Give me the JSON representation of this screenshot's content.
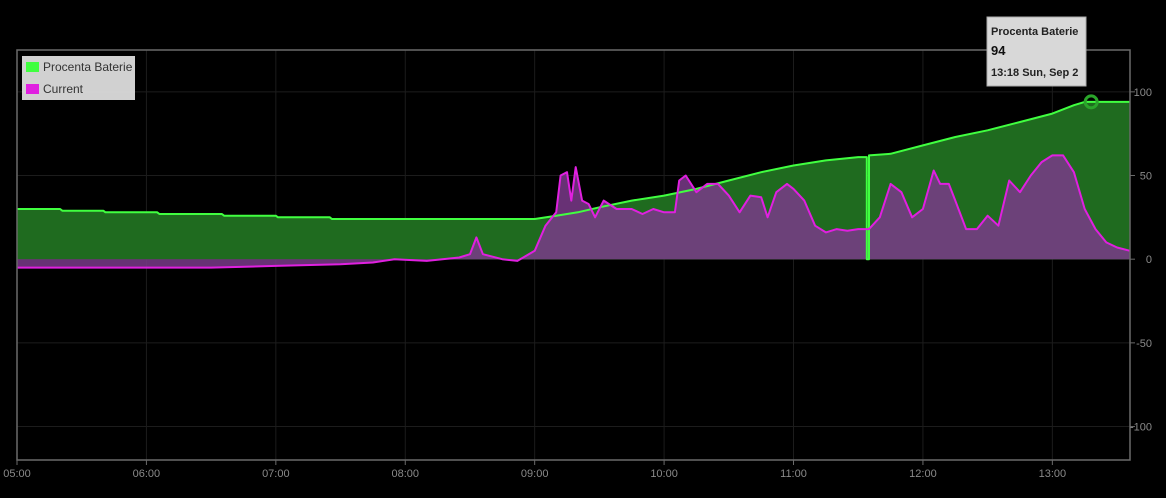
{
  "chart_data": {
    "type": "area",
    "x_range": [
      "05:00",
      "13:36"
    ],
    "x_ticks": [
      "05:00",
      "06:00",
      "07:00",
      "08:00",
      "09:00",
      "10:00",
      "11:00",
      "12:00",
      "13:00"
    ],
    "y_ticks": [
      "100",
      "50",
      "0",
      "-50",
      "-100"
    ],
    "ylim": [
      -120,
      125
    ],
    "y_axis_side": "right",
    "grid": true,
    "legend_placement": "top-left",
    "series": [
      {
        "name": "Procenta Baterie",
        "color": "#40ff40",
        "fill": "#1f6b1f",
        "points": [
          [
            "05:00",
            30
          ],
          [
            "05:20",
            30
          ],
          [
            "05:21",
            29
          ],
          [
            "05:40",
            29
          ],
          [
            "05:41",
            28
          ],
          [
            "06:05",
            28
          ],
          [
            "06:06",
            27
          ],
          [
            "06:35",
            27
          ],
          [
            "06:36",
            26
          ],
          [
            "07:00",
            26
          ],
          [
            "07:01",
            25
          ],
          [
            "07:25",
            25
          ],
          [
            "07:26",
            24
          ],
          [
            "09:00",
            24
          ],
          [
            "09:10",
            26
          ],
          [
            "09:20",
            28
          ],
          [
            "09:30",
            31
          ],
          [
            "09:45",
            35
          ],
          [
            "10:00",
            38
          ],
          [
            "10:15",
            42
          ],
          [
            "10:30",
            47
          ],
          [
            "10:45",
            52
          ],
          [
            "11:00",
            56
          ],
          [
            "11:15",
            59
          ],
          [
            "11:30",
            61
          ],
          [
            "11:34",
            61
          ],
          [
            "11:34",
            0
          ],
          [
            "11:35",
            0
          ],
          [
            "11:35",
            62
          ],
          [
            "11:45",
            63
          ],
          [
            "12:00",
            68
          ],
          [
            "12:15",
            73
          ],
          [
            "12:30",
            77
          ],
          [
            "12:45",
            82
          ],
          [
            "13:00",
            87
          ],
          [
            "13:10",
            92
          ],
          [
            "13:15",
            94
          ],
          [
            "13:36",
            94
          ]
        ]
      },
      {
        "name": "Current",
        "color": "#e020e0",
        "fill": "#7a3a8a",
        "points": [
          [
            "05:00",
            -5
          ],
          [
            "05:30",
            -5
          ],
          [
            "06:00",
            -5
          ],
          [
            "06:30",
            -5
          ],
          [
            "07:00",
            -4
          ],
          [
            "07:30",
            -3
          ],
          [
            "07:45",
            -2
          ],
          [
            "07:55",
            0
          ],
          [
            "08:10",
            -1
          ],
          [
            "08:25",
            1
          ],
          [
            "08:30",
            3
          ],
          [
            "08:33",
            13
          ],
          [
            "08:36",
            3
          ],
          [
            "08:45",
            0
          ],
          [
            "08:52",
            -1
          ],
          [
            "09:00",
            5
          ],
          [
            "09:05",
            20
          ],
          [
            "09:10",
            28
          ],
          [
            "09:12",
            50
          ],
          [
            "09:15",
            52
          ],
          [
            "09:17",
            35
          ],
          [
            "09:19",
            55
          ],
          [
            "09:22",
            35
          ],
          [
            "09:25",
            33
          ],
          [
            "09:28",
            25
          ],
          [
            "09:32",
            35
          ],
          [
            "09:38",
            30
          ],
          [
            "09:45",
            30
          ],
          [
            "09:50",
            27
          ],
          [
            "09:55",
            30
          ],
          [
            "10:00",
            28
          ],
          [
            "10:05",
            28
          ],
          [
            "10:07",
            47
          ],
          [
            "10:10",
            50
          ],
          [
            "10:15",
            40
          ],
          [
            "10:20",
            45
          ],
          [
            "10:25",
            45
          ],
          [
            "10:30",
            38
          ],
          [
            "10:35",
            28
          ],
          [
            "10:40",
            38
          ],
          [
            "10:45",
            37
          ],
          [
            "10:48",
            25
          ],
          [
            "10:52",
            40
          ],
          [
            "10:57",
            45
          ],
          [
            "11:00",
            42
          ],
          [
            "11:05",
            35
          ],
          [
            "11:10",
            20
          ],
          [
            "11:15",
            16
          ],
          [
            "11:20",
            18
          ],
          [
            "11:25",
            17
          ],
          [
            "11:30",
            18
          ],
          [
            "11:35",
            18
          ],
          [
            "11:40",
            25
          ],
          [
            "11:45",
            45
          ],
          [
            "11:50",
            40
          ],
          [
            "11:55",
            25
          ],
          [
            "12:00",
            30
          ],
          [
            "12:05",
            53
          ],
          [
            "12:08",
            45
          ],
          [
            "12:12",
            45
          ],
          [
            "12:15",
            35
          ],
          [
            "12:20",
            18
          ],
          [
            "12:25",
            18
          ],
          [
            "12:30",
            26
          ],
          [
            "12:35",
            20
          ],
          [
            "12:40",
            47
          ],
          [
            "12:45",
            40
          ],
          [
            "12:50",
            50
          ],
          [
            "12:55",
            58
          ],
          [
            "13:00",
            62
          ],
          [
            "13:05",
            62
          ],
          [
            "13:10",
            52
          ],
          [
            "13:15",
            30
          ],
          [
            "13:20",
            18
          ],
          [
            "13:25",
            10
          ],
          [
            "13:30",
            7
          ],
          [
            "13:36",
            5
          ]
        ]
      }
    ],
    "tooltip": {
      "series": "Procenta Baterie",
      "value": "94",
      "time": "13:18 Sun, Sep 2",
      "x": "13:18",
      "y": 94
    }
  }
}
